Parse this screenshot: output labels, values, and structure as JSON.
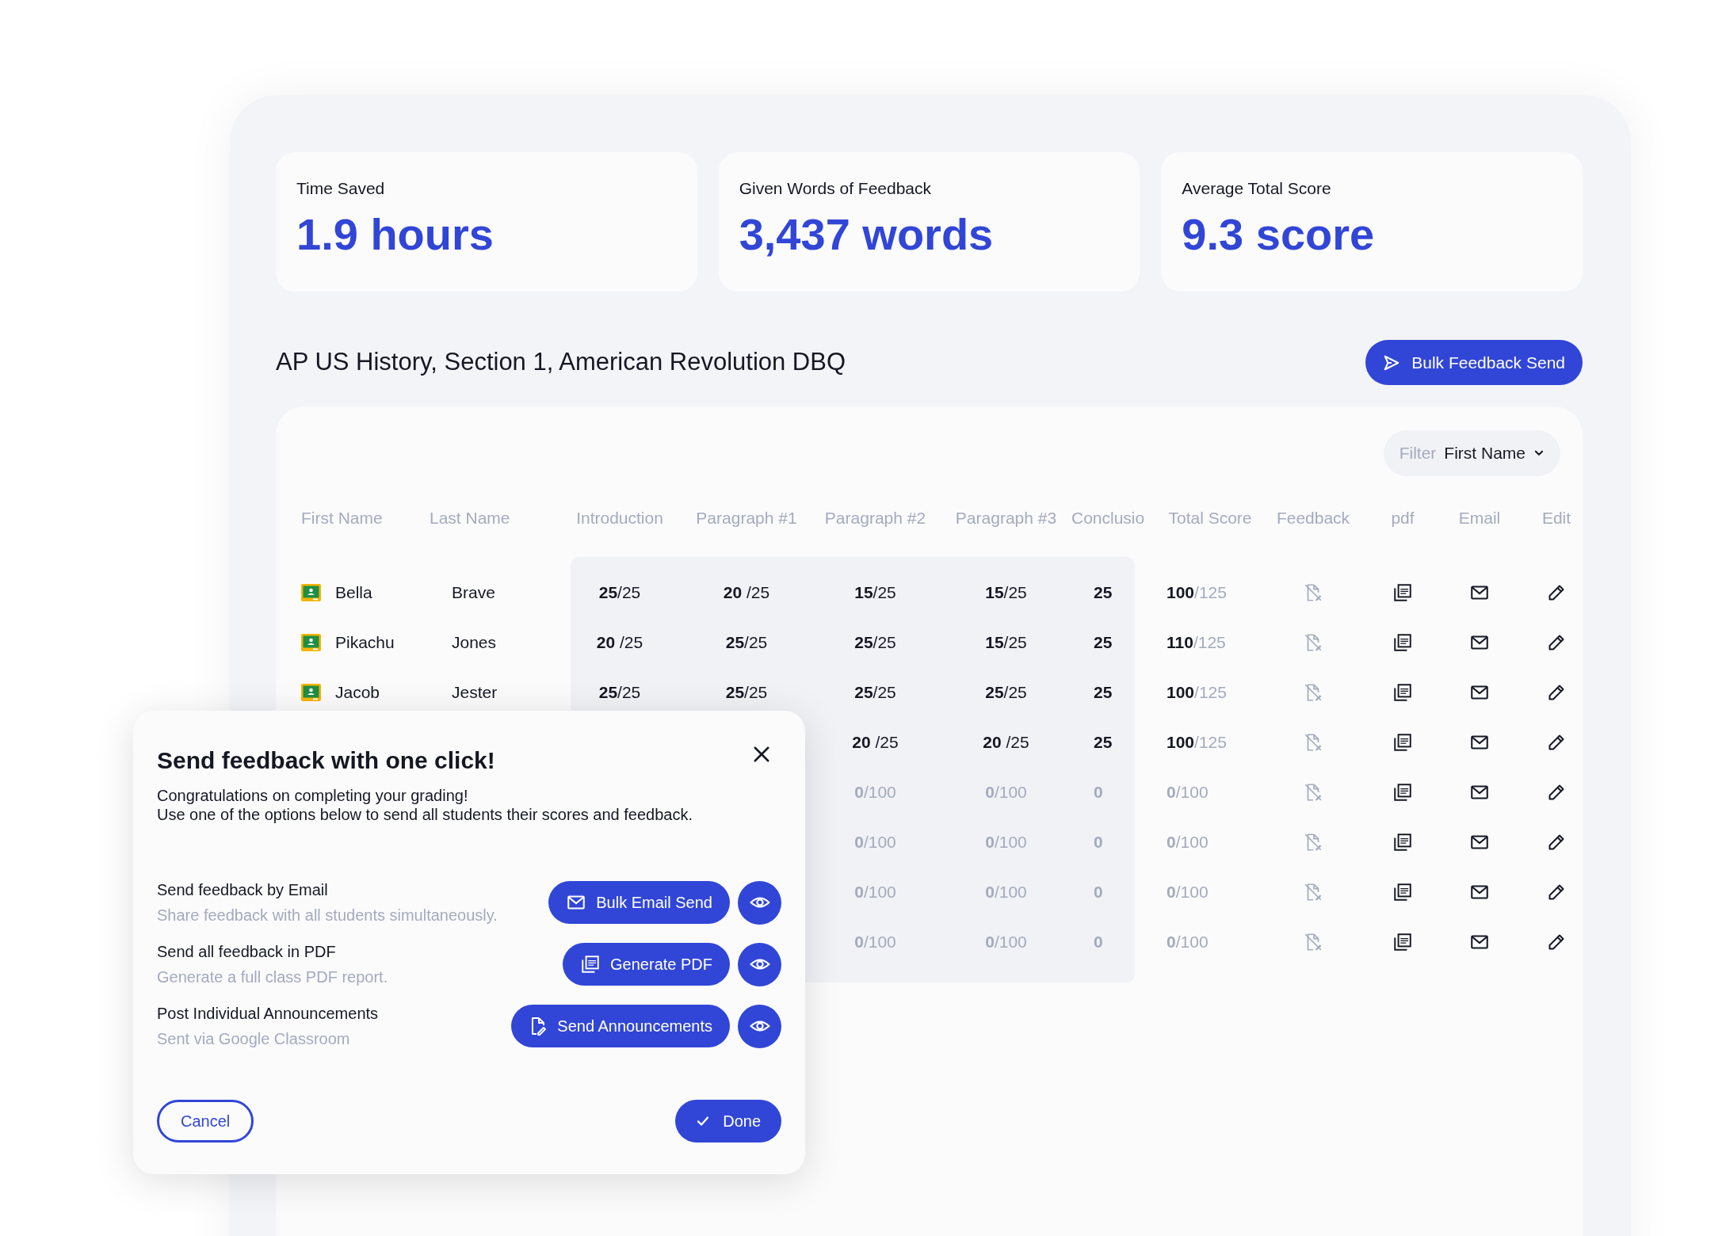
{
  "stats": [
    {
      "label": "Time Saved",
      "value": "1.9 hours"
    },
    {
      "label": "Given Words of Feedback",
      "value": "3,437 words"
    },
    {
      "label": "Average Total Score",
      "value": "9.3 score"
    }
  ],
  "assignment_title": "AP US History, Section 1, American Revolution DBQ",
  "bulk_button": "Bulk Feedback Send",
  "filter": {
    "label": "Filter",
    "value": "First Name"
  },
  "table": {
    "columns": [
      "First Name",
      "Last Name",
      "Introduction",
      "Paragraph #1",
      "Paragraph #2",
      "Paragraph #3",
      "Conclusio",
      "Total Score",
      "Feedback",
      "pdf",
      "Email",
      "Edit"
    ],
    "rows": [
      {
        "graded": true,
        "first_name": "Bella",
        "last_name": "Brave",
        "introduction": "**25**/25",
        "paragraph_1": "**20** /25",
        "paragraph_2": "**15**/25",
        "paragraph_3": "**15**/25",
        "conclusion": "25",
        "total": "**100**/125"
      },
      {
        "graded": true,
        "first_name": "Pikachu",
        "last_name": "Jones",
        "introduction": "**20** /25",
        "paragraph_1": "**25**/25",
        "paragraph_2": "**25**/25",
        "paragraph_3": "**15**/25",
        "conclusion": "25",
        "total": "**110**/125"
      },
      {
        "graded": true,
        "first_name": "Jacob",
        "last_name": "Jester",
        "introduction": "**25**/25",
        "paragraph_1": "**25**/25",
        "paragraph_2": "**25**/25",
        "paragraph_3": "**25**/25",
        "conclusion": "25",
        "total": "**100**/125"
      },
      {
        "graded": true,
        "paragraph_2": "**20** /25",
        "paragraph_3": "**20** /25",
        "conclusion": "25",
        "total": "**100**/125"
      },
      {
        "graded": false,
        "paragraph_2": "**0**/100",
        "paragraph_3": "**0**/100",
        "conclusion": "0",
        "total": "**0**/100"
      },
      {
        "graded": false,
        "paragraph_2": "**0**/100",
        "paragraph_3": "**0**/100",
        "conclusion": "0",
        "total": "**0**/100"
      },
      {
        "graded": false,
        "paragraph_2": "**0**/100",
        "paragraph_3": "**0**/100",
        "conclusion": "0",
        "total": "**0**/100"
      },
      {
        "graded": false,
        "paragraph_2": "**0**/100",
        "paragraph_3": "**0**/100",
        "conclusion": "0",
        "total": "**0**/100"
      }
    ]
  },
  "dialog": {
    "title": "Send feedback with one click!",
    "message_lines": [
      "Congratulations on completing your grading!",
      "Use one of the options below to send all students their scores and feedback."
    ],
    "options": [
      {
        "kind": "email",
        "title": "Send feedback by Email",
        "subtitle": "Share feedback with all students simultaneously.",
        "button": "Bulk Email Send"
      },
      {
        "kind": "pdf",
        "title": "Send all feedback in PDF",
        "subtitle": "Generate a full class PDF report.",
        "button": "Generate PDF"
      },
      {
        "kind": "announcement",
        "title": "Post Individual Announcements",
        "subtitle": "Sent via Google Classroom",
        "button": "Send Announcements"
      }
    ],
    "cancel": "Cancel",
    "done": "Done"
  }
}
